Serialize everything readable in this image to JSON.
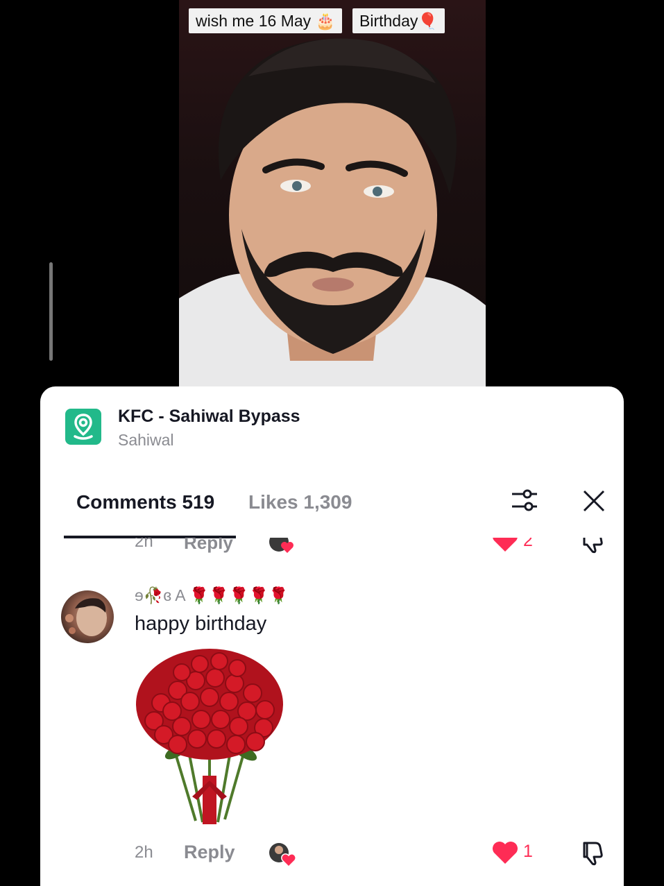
{
  "video": {
    "caption_tags": [
      "wish me 16 May 🎂",
      "Birthday🎈"
    ]
  },
  "location": {
    "name": "KFC - Sahiwal Bypass",
    "city": "Sahiwal",
    "icon": "location-pin-icon",
    "icon_color": "#22b98a"
  },
  "tabs": {
    "comments_label": "Comments 519",
    "likes_label": "Likes 1,309"
  },
  "previous_comment": {
    "time": "2h",
    "reply_label": "Reply",
    "like_count": "2"
  },
  "comment": {
    "username": "ɘ🥀ɞ A 🌹🌹🌹🌹🌹",
    "text": "happy birthday",
    "time": "2h",
    "reply_label": "Reply",
    "like_count": "1"
  },
  "colors": {
    "like_red": "#fe2c55",
    "text_primary": "#161823",
    "text_secondary": "#8a8b91"
  }
}
